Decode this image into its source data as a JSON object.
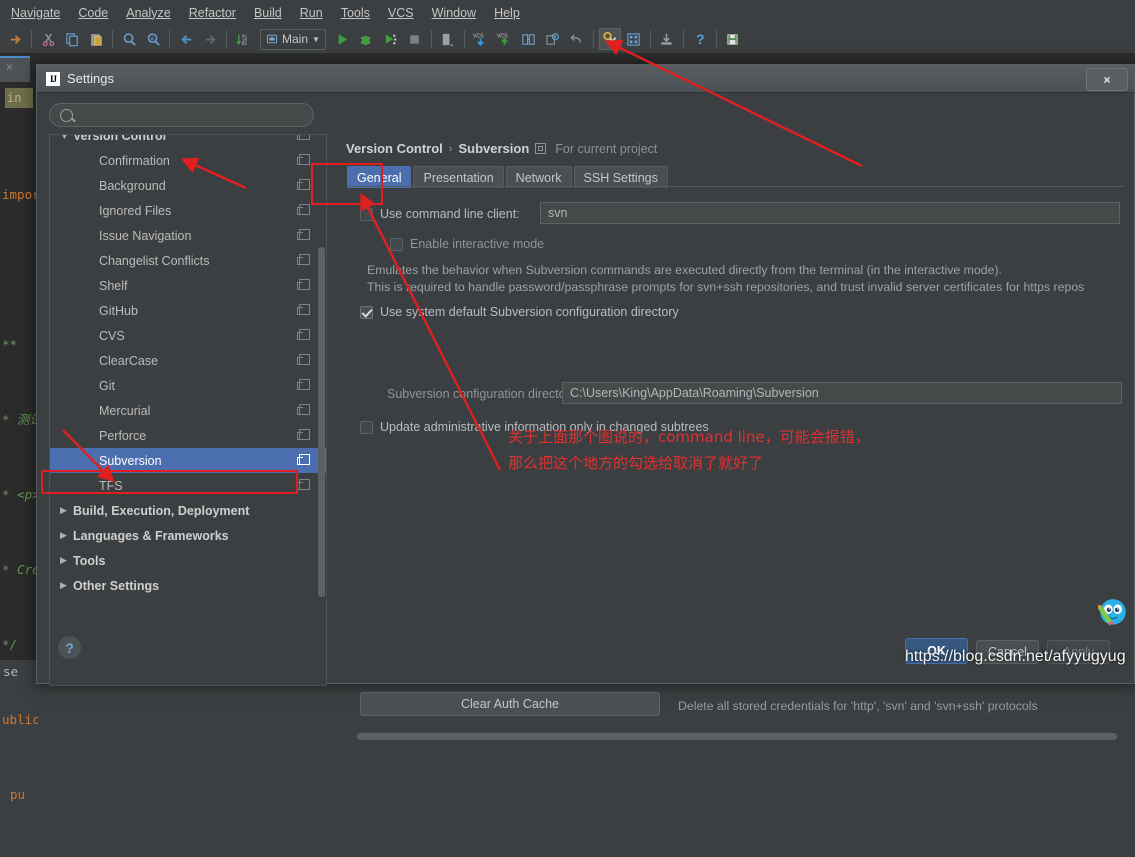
{
  "ide": {
    "menubar": [
      "Navigate",
      "Code",
      "Analyze",
      "Refactor",
      "Build",
      "Run",
      "Tools",
      "VCS",
      "Window",
      "Help"
    ],
    "run_config": "Main",
    "toolbar_icons": [
      "forward-arrow-icon",
      "cut-icon",
      "copy-icon",
      "paste-icon",
      "find-icon",
      "find-usages-icon",
      "back-icon",
      "forward-icon",
      "toggle-bookmarks-icon",
      "run-icon",
      "debug-icon",
      "coverage-icon",
      "stop-icon",
      "rollback-icon",
      "vcs-update-icon",
      "vcs-commit-icon",
      "compare-icon",
      "history-icon",
      "undo-icon",
      "settings-icon",
      "project-structure-icon",
      "install-icon",
      "help-icon",
      "sdk-icon"
    ],
    "editor_code_lines": [
      "import",
      "**",
      "* 测试",
      "* <p>",
      "* Cre",
      "*/",
      "ublic",
      "pu"
    ],
    "editor_bottom_text": "se",
    "editor_tab_label": "in"
  },
  "dialog": {
    "title": "Settings",
    "app_icon": "IJ",
    "close_label": "×",
    "search": {
      "value": "",
      "placeholder": "",
      "icon": "search-icon"
    },
    "sidebar": {
      "items": [
        {
          "label": "Version Control",
          "level": 0,
          "bold": true,
          "arrow": "▼",
          "copy": true,
          "selected": false
        },
        {
          "label": "Confirmation",
          "level": 1,
          "bold": false,
          "arrow": "",
          "copy": true,
          "selected": false
        },
        {
          "label": "Background",
          "level": 1,
          "bold": false,
          "arrow": "",
          "copy": true,
          "selected": false
        },
        {
          "label": "Ignored Files",
          "level": 1,
          "bold": false,
          "arrow": "",
          "copy": true,
          "selected": false
        },
        {
          "label": "Issue Navigation",
          "level": 1,
          "bold": false,
          "arrow": "",
          "copy": true,
          "selected": false
        },
        {
          "label": "Changelist Conflicts",
          "level": 1,
          "bold": false,
          "arrow": "",
          "copy": true,
          "selected": false
        },
        {
          "label": "Shelf",
          "level": 1,
          "bold": false,
          "arrow": "",
          "copy": true,
          "selected": false
        },
        {
          "label": "GitHub",
          "level": 1,
          "bold": false,
          "arrow": "",
          "copy": true,
          "selected": false
        },
        {
          "label": "CVS",
          "level": 1,
          "bold": false,
          "arrow": "",
          "copy": true,
          "selected": false
        },
        {
          "label": "ClearCase",
          "level": 1,
          "bold": false,
          "arrow": "",
          "copy": true,
          "selected": false
        },
        {
          "label": "Git",
          "level": 1,
          "bold": false,
          "arrow": "",
          "copy": true,
          "selected": false
        },
        {
          "label": "Mercurial",
          "level": 1,
          "bold": false,
          "arrow": "",
          "copy": true,
          "selected": false
        },
        {
          "label": "Perforce",
          "level": 1,
          "bold": false,
          "arrow": "",
          "copy": true,
          "selected": false
        },
        {
          "label": "Subversion",
          "level": 1,
          "bold": false,
          "arrow": "",
          "copy": true,
          "selected": true
        },
        {
          "label": "TFS",
          "level": 1,
          "bold": false,
          "arrow": "",
          "copy": true,
          "selected": false
        },
        {
          "label": "Build, Execution, Deployment",
          "level": 0,
          "bold": true,
          "arrow": "▶",
          "copy": false,
          "selected": false
        },
        {
          "label": "Languages & Frameworks",
          "level": 0,
          "bold": true,
          "arrow": "▶",
          "copy": false,
          "selected": false
        },
        {
          "label": "Tools",
          "level": 0,
          "bold": true,
          "arrow": "▶",
          "copy": false,
          "selected": false
        },
        {
          "label": "Other Settings",
          "level": 0,
          "bold": true,
          "arrow": "▶",
          "copy": false,
          "selected": false
        }
      ]
    },
    "breadcrumb": {
      "root": "Version Control",
      "separator": "›",
      "leaf": "Subversion",
      "scope": "For current project",
      "scope_icon": "project-scope-icon"
    },
    "tabs": [
      {
        "label": "General",
        "active": true
      },
      {
        "label": "Presentation",
        "active": false
      },
      {
        "label": "Network",
        "active": false
      },
      {
        "label": "SSH Settings",
        "active": false
      }
    ],
    "general": {
      "use_cmdline_label": "Use command line client:",
      "use_cmdline_checked": false,
      "cmdline_value": "svn",
      "interactive_label": "Enable interactive mode",
      "interactive_checked": false,
      "interactive_desc_line1": "Emulates the behavior when Subversion commands are executed directly from the terminal (in the interactive mode).",
      "interactive_desc_line2": "This is required to handle password/passphrase prompts for svn+ssh repositories, and trust invalid server certificates for https repos",
      "use_default_dir_label": "Use system default Subversion configuration directory",
      "use_default_dir_checked": true,
      "config_dir_label": "Subversion configuration directory:",
      "config_dir_value": "C:\\Users\\King\\AppData\\Roaming\\Subversion",
      "update_admin_label": "Update administrative information only in changed subtrees",
      "update_admin_checked": false,
      "clear_auth_label": "Clear Auth Cache",
      "clear_auth_note": "Delete all stored credentials for 'http', 'svn' and 'svn+ssh' protocols"
    },
    "footer": {
      "help_label": "?",
      "ok_label": "OK",
      "cancel_label": "Cancel",
      "apply_label": "Apply"
    }
  },
  "annotations": {
    "note_line1": "关于上面那个图说的，command line，可能会报错，",
    "note_line2": "那么把这个地方的勾选给取消了就好了",
    "color": "#e03030",
    "watermark": "https://blog.csdn.net/afyyugyug",
    "mascot_icon": "csdn-mascot-icon"
  }
}
